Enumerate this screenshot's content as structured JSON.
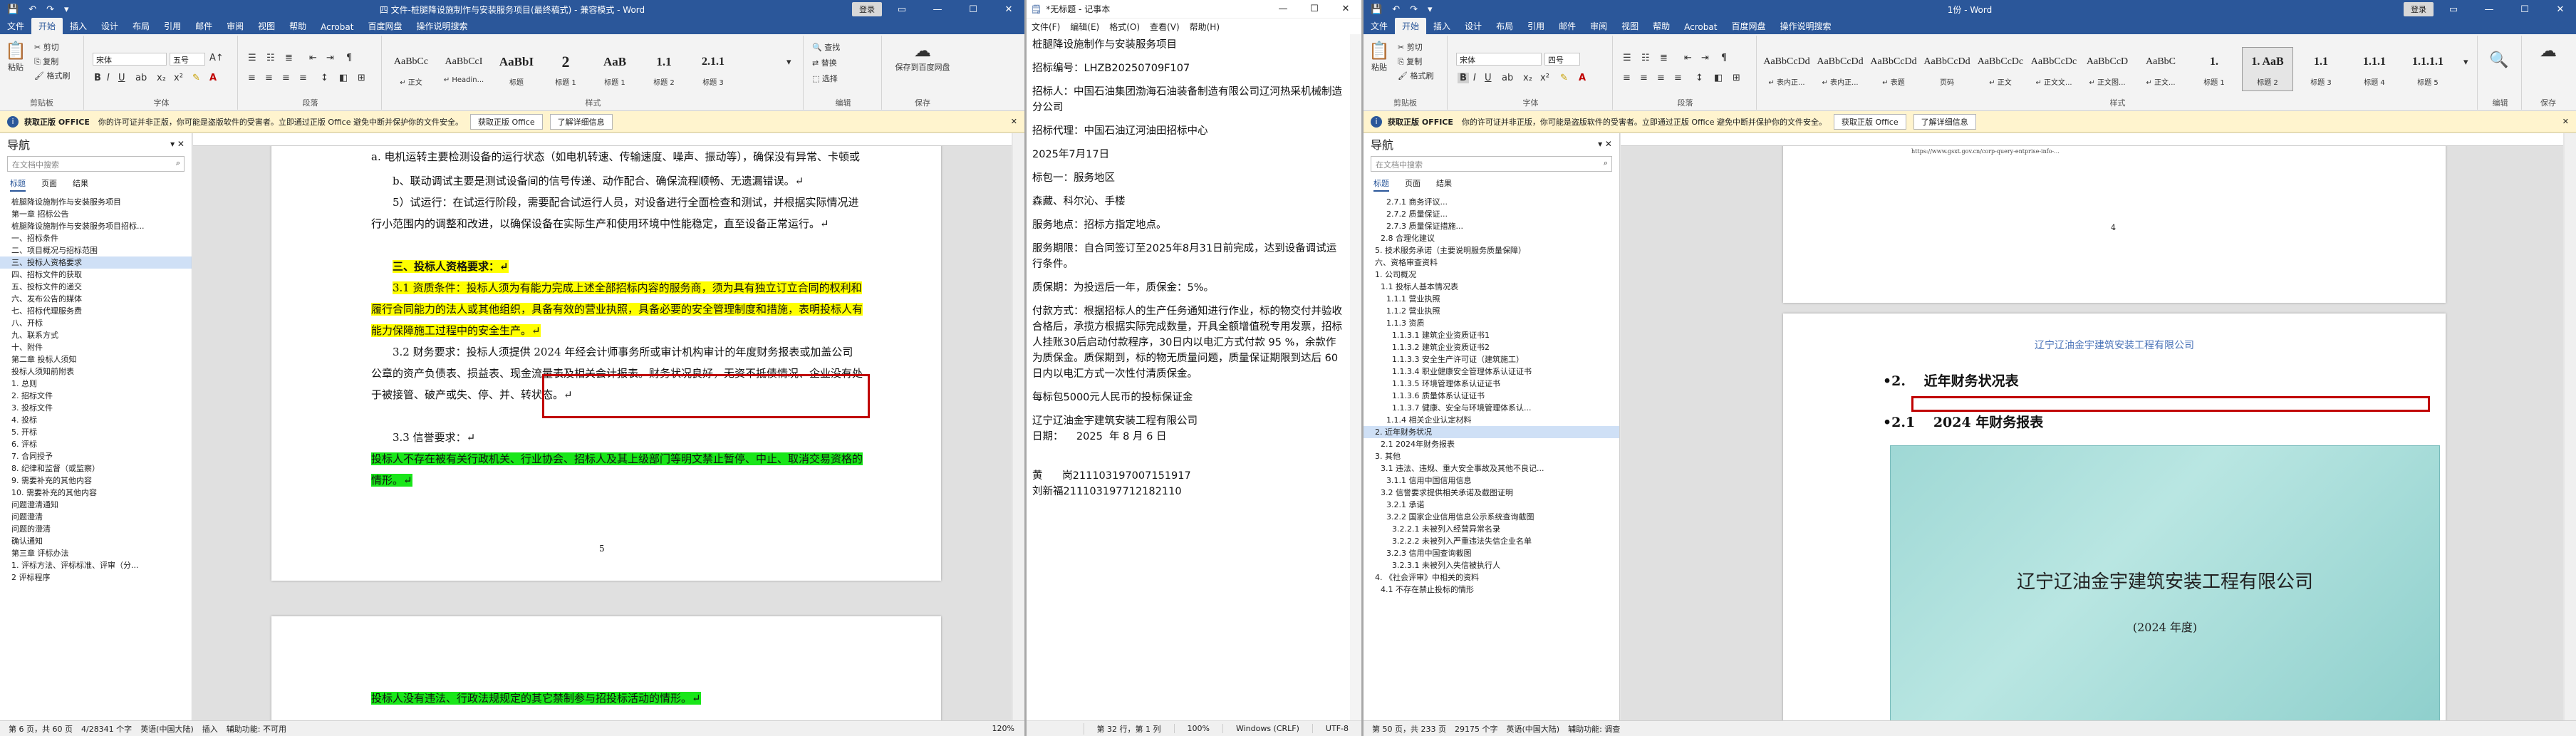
{
  "colors": {
    "word_blue": "#2b579a",
    "highlight_yellow": "#ffff00",
    "highlight_green": "#19e619",
    "red_box": "#c00000",
    "info_bar": "#fff4ce"
  },
  "w1": {
    "title": "四 文件-桩腿降设施制作与安装服务项目(最终稿式) - 兼容模式 - Word",
    "share_btn": "登录",
    "menu": [
      "文件",
      "开始",
      "插入",
      "设计",
      "布局",
      "引用",
      "邮件",
      "审阅",
      "视图",
      "帮助",
      "Acrobat",
      "百度网盘",
      "操作说明搜索"
    ],
    "ribbon": {
      "clipboard_label": "剪贴板",
      "paste": "粘贴",
      "cut": "剪切",
      "copy": "复制",
      "format_painter": "格式刷",
      "font_name": "宋体",
      "font_size": "五号",
      "font_label": "字体",
      "para_label": "段落",
      "styles_label": "样式",
      "edit_label": "编辑",
      "save_label": "保存",
      "styles": [
        {
          "p": "AaBbCc",
          "n": "↵ 正文"
        },
        {
          "p": "AaBbCcI",
          "n": "↵ Headin..."
        },
        {
          "p": "AaBbI",
          "n": "标题"
        },
        {
          "p": "2",
          "n": "标题 1"
        },
        {
          "p": "AaB",
          "n": "标题 1"
        },
        {
          "p": "1.1",
          "n": "标题 2"
        },
        {
          "p": "2.1.1",
          "n": "标题 3"
        }
      ],
      "find": "查找",
      "replace": "替换",
      "select": "选择",
      "baidu_save": "保存到百度网盘"
    },
    "info": {
      "title": "获取正版 OFFICE",
      "text": "你的许可证并非正版，你可能是盗版软件的受害者。立即通过正版 Office 避免中断并保护你的文件安全。",
      "btn1": "获取正版 Office",
      "btn2": "了解详细信息"
    },
    "nav": {
      "title": "导航",
      "search": "在文档中搜索",
      "tabs": [
        "标题",
        "页面",
        "结果"
      ],
      "items": [
        "桩腿降设施制作与安装服务项目",
        "第一章  招标公告",
        "桩腿降设施制作与安装服务项目招标...",
        "一、招标条件",
        "二、项目概况与招标范围",
        "三、投标人资格要求",
        "四、招标文件的获取",
        "五、投标文件的递交",
        "六、发布公告的媒体",
        "七、招标代理服务费",
        "八、开标",
        "九、联系方式",
        "十、附件",
        "第二章  投标人须知",
        "投标人须知前附表",
        "1. 总则",
        "2. 招标文件",
        "3. 投标文件",
        "4. 投标",
        "5. 开标",
        "6. 评标",
        "7. 合同授予",
        "8. 纪律和监督（或监察）",
        "9. 需要补充的其他内容",
        "10. 需要补充的其他内容",
        "问题澄清通知",
        "问题澄清",
        "问题的澄清",
        "确认通知",
        "第三章  评标办法",
        "1. 评标方法、评标标准、评审（分...",
        "2 评标程序"
      ],
      "current": 5
    },
    "doc": {
      "p0": "a. 电机运转主要检测设备的运行状态（如电机转速、传输速度、噪声、振动等），确保没有异常、卡顿或振动等现象；↵",
      "p1": "b、联动调试主要是测试设备间的信号传递、动作配合、确保流程顺畅、无遗漏错误。↵",
      "p2": "5）试运行：在试运行阶段，需要配合试运行人员，对设备进行全面检查和测试，并根据实际情况进行小范围内的调整和改进，以确保设备在实际生产和使用环境中性能稳定，直至设备正常运行。↵",
      "heading": "三、投标人资格要求：↵",
      "s31": "3.1 资质条件：投标人须为有能力完成上述全部招标内容的服务商，须为具有独立订立合同的权利和履行合同能力的法人或其他组织，具备有效的营业执照，具备必要的安全管理制度和措施，表明投标人有能力保障施工过程中的安全生产。↵",
      "s32": "3.2 财务要求：投标人须提供 2024 年经会计师事务所或审计机构审计的年度财务报表或加盖公司公章的资产负债表、损益表、现金流量表及相关会计报表。财务状况良好，无资不抵债情况、企业没有处于被接管、破产或失、停、并、转状态。↵",
      "s33": "3.3 信誉要求：↵",
      "s33b": "投标人不存在被有关行政机关、行业协会、招标人及其上级部门等明文禁止暂停、中止、取消交易资格的情形。↵",
      "page_num": "5",
      "s34": "投标人没有违法、行政法规规定的其它禁制参与招投标活动的情形。↵"
    },
    "status": {
      "page": "第 6 页，共 60 页",
      "words": "4/28341 个字",
      "lang": "英语(中国大陆)",
      "input": "插入",
      "macro": "辅助功能: 不可用",
      "zoom": "120%"
    }
  },
  "w2": {
    "title": "*无标题 - 记事本",
    "menu": [
      "文件(F)",
      "编辑(E)",
      "格式(O)",
      "查看(V)",
      "帮助(H)"
    ],
    "lines": [
      "桩腿降设施制作与安装服务项目",
      "",
      "招标编号：LHZB20250709F107",
      "",
      "招标人：中国石油集团渤海石油装备制造有限公司辽河热采机械制造分公司",
      "",
      "招标代理：中国石油辽河油田招标中心",
      "",
      "2025年7月17日",
      "",
      "标包一：服务地区",
      "",
      "森藏、科尔沁、手楼",
      "",
      "服务地点：招标方指定地点。",
      "",
      "服务期限：自合同签订至2025年8月31日前完成，达到设备调试运行条件。",
      "",
      "质保期：为投运后一年，质保金：5%。",
      "",
      "付款方式：根据招标人的生产任务通知进行作业，标的物交付并验收合格后，承揽方根据实际完成数量，开具全额增值税专用发票，招标人挂账30后启动付款程序，30日内以电汇方式付款 95 %，余款作为质保金。质保期到，标的物无质量问题，质量保证期限到达后 60 日内以电汇方式一次性付清质保金。",
      "",
      "每标包5000元人民币的投标保证金",
      "",
      "辽宁辽油金宇建筑安装工程有限公司",
      "日期：    2025  年 8 月 6 日",
      "",
      "",
      "",
      "黄      岗211103197007151917",
      "刘新福211103197712182110"
    ],
    "status": [
      "第 32 行，第 1 列",
      "100%",
      "Windows (CRLF)",
      "UTF-8"
    ]
  },
  "w3": {
    "title": "1份 - Word",
    "share_btn": "登录",
    "menu": [
      "文件",
      "开始",
      "插入",
      "设计",
      "布局",
      "引用",
      "邮件",
      "审阅",
      "视图",
      "帮助",
      "Acrobat",
      "百度网盘",
      "操作说明搜索"
    ],
    "ribbon": {
      "font_name": "宋体",
      "font_size": "四号",
      "styles": [
        {
          "p": "AaBbCcDd",
          "n": "↵ 表内正..."
        },
        {
          "p": "AaBbCcDd",
          "n": "↵ 表内正..."
        },
        {
          "p": "AaBbCcDd",
          "n": "↵ 表题"
        },
        {
          "p": "AaBbCcDd",
          "n": "页码"
        },
        {
          "p": "AaBbCcDc",
          "n": "↵ 正文"
        },
        {
          "p": "AaBbCcDc",
          "n": "↵ 正文文..."
        },
        {
          "p": "AaBbCcD",
          "n": "↵ 正文图..."
        },
        {
          "p": "AaBbC",
          "n": "↵ 正文..."
        },
        {
          "p": "1.",
          "n": "标题 1"
        },
        {
          "p": "1. AaB",
          "n": "标题 2"
        },
        {
          "p": "1.1",
          "n": "标题 3"
        },
        {
          "p": "1.1.1",
          "n": "标题 4"
        },
        {
          "p": "1.1.1.1",
          "n": "标题 5"
        }
      ]
    },
    "nav": {
      "title": "导航",
      "search": "在文档中搜索",
      "tabs": [
        "标题",
        "页面",
        "结果"
      ],
      "items": [
        "2.7.1 商务评议...",
        "2.7.2 质量保证...",
        "2.7.3 质量保证措施...",
        "2.8 合理化建议",
        "5. 技术服务承诺（主要说明服务质量保障）",
        "六、资格审查资料",
        "1. 公司概况",
        "1.1 投标人基本情况表",
        "1.1.1 营业执照",
        "1.1.2 营业执照",
        "1.1.3 资质",
        "1.1.3.1 建筑企业资质证书1",
        "1.1.3.2 建筑企业资质证书2",
        "1.1.3.3 安全生产许可证（建筑施工）",
        "1.1.3.4 职业健康安全管理体系认证证书",
        "1.1.3.5 环境管理体系认证证书",
        "1.1.3.6 质量体系认证证书",
        "1.1.3.7 健康、安全与环境管理体系认...",
        "1.1.4 相关企业认定材料",
        "2. 近年财务状况",
        "2.1 2024年财务报表",
        "3. 其他",
        "3.1 违法、违规、重大安全事故及其他不良记...",
        "3.1.1 信用中国信用信息",
        "3.2 信誉要求提供相关承诺及截图证明",
        "3.2.1 承诺",
        "3.2.2 国家企业信用信息公示系统查询截图",
        "3.2.2.1 未被列入经营异常名录",
        "3.2.2.2 未被列入严重违法失信企业名单",
        "3.2.3 信用中国查询截图",
        "3.2.3.1 未被列入失信被执行人",
        "4. 《社会评审》中相关的资料",
        "4.1 不存在禁止投标的情形"
      ],
      "current": 19
    },
    "doc": {
      "url": "https://www.gsxt.gov.cn/corp-query-entprise-info-...",
      "page_num": "4",
      "company_line": "辽宁辽油金宇建筑安装工程有限公司",
      "h2": "•2.　 近年财务状况表",
      "h21": "•2.1　 2024 年财务报表",
      "cover_company": "辽宁辽油金宇建筑安装工程有限公司",
      "cover_year": "(2024 年度)"
    },
    "status": {
      "page": "第 50 页，共 233 页",
      "words": "29175 个字",
      "lang": "英语(中国大陆)",
      "macro": "辅助功能: 调查"
    }
  }
}
